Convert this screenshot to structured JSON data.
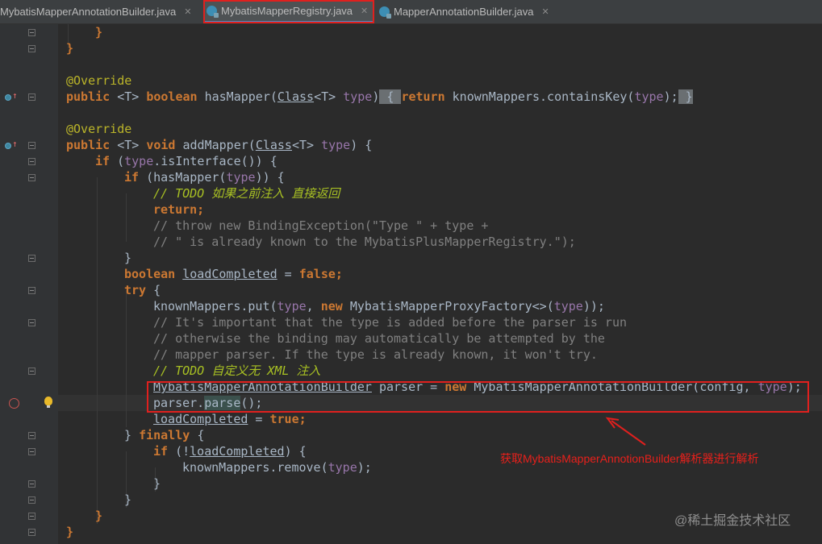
{
  "tabs": [
    {
      "label": "MybatisMapperAnnotationBuilder.java",
      "active": false
    },
    {
      "label": "MybatisMapperRegistry.java",
      "active": true
    },
    {
      "label": "MapperAnnotationBuilder.java",
      "active": false
    }
  ],
  "close_glyph": "✕",
  "code": {
    "l1": "}",
    "l2": "}",
    "l4_ann": "@Override",
    "l5_public": "public ",
    "l5_t": "<T> ",
    "l5_bool": "boolean ",
    "l5_name": "hasMapper(",
    "l5_class": "Class",
    "l5_typearg": "<T> ",
    "l5_param": "type",
    "l5_paren": ")",
    "l5_open": " { ",
    "l5_return": "return ",
    "l5_body": "knownMappers.containsKey(",
    "l5_arg": "type",
    "l5_end": ");",
    "l5_close": " }",
    "l7_ann": "@Override",
    "l8_public": "public ",
    "l8_t": "<T> ",
    "l8_void": "void ",
    "l8_name": "addMapper(",
    "l8_class": "Class",
    "l8_typearg": "<T> ",
    "l8_param": "type",
    "l8_rest": ") {",
    "l9_if": "if ",
    "l9_p1": "(",
    "l9_type": "type",
    "l9_rest": ".isInterface()) {",
    "l10_if": "if ",
    "l10_p1": "(hasMapper(",
    "l10_type": "type",
    "l10_rest": ")) {",
    "l11_pre": "// ",
    "l11_todo": "TODO 如果之前注入 直接返回",
    "l12": "return;",
    "l13": "// throw new BindingException(\"Type \" + type +",
    "l14": "// \" is already known to the MybatisPlusMapperRegistry.\");",
    "l15": "}",
    "l16_bool": "boolean ",
    "l16_var": "loadCompleted",
    "l16_eq": " = ",
    "l16_false": "false",
    "l16_semi": ";",
    "l17_try": "try ",
    "l17_brace": "{",
    "l18_a": "knownMappers.put(",
    "l18_type": "type",
    "l18_b": ", ",
    "l18_new": "new ",
    "l18_c": "MybatisMapperProxyFactory",
    "l18_diamond": "<>",
    "l18_d": "(",
    "l18_type2": "type",
    "l18_e": "));",
    "l19": "// It's important that the type is added before the parser is run",
    "l20": "// otherwise the binding may automatically be attempted by the",
    "l21": "// mapper parser. If the type is already known, it won't try.",
    "l22_pre": "// ",
    "l22_todo": "TODO 自定义无 XML 注入",
    "l23_cls": "MybatisMapperAnnotationBuilder",
    "l23_a": " parser = ",
    "l23_new": "new ",
    "l23_b": "MybatisMapperAnnotationBuilder(config, ",
    "l23_type": "type",
    "l23_c": ");",
    "l24_a": "parser.",
    "l24_m": "parse",
    "l24_b": "();",
    "l25_var": "loadCompleted",
    "l25_eq": " = ",
    "l25_true": "true",
    "l25_semi": ";",
    "l26_close": "} ",
    "l26_finally": "finally ",
    "l26_brace": "{",
    "l27_if": "if ",
    "l27_a": "(!",
    "l27_var": "loadCompleted",
    "l27_b": ") {",
    "l28_a": "knownMappers.remove(",
    "l28_type": "type",
    "l28_b": ");",
    "l29": "}",
    "l30": "}",
    "l31": "}",
    "l32": "}"
  },
  "annotation_text": "获取MybatisMapperAnnotionBuilder解析器进行解析",
  "watermark": "@稀土掘金技术社区",
  "colors": {
    "keyword": "#cc7832",
    "annotation": "#bbb529",
    "param": "#9876aa",
    "comment": "#808080",
    "todo": "#a8c023",
    "method": "#ffc66d",
    "highlight_red": "#e0201e"
  }
}
